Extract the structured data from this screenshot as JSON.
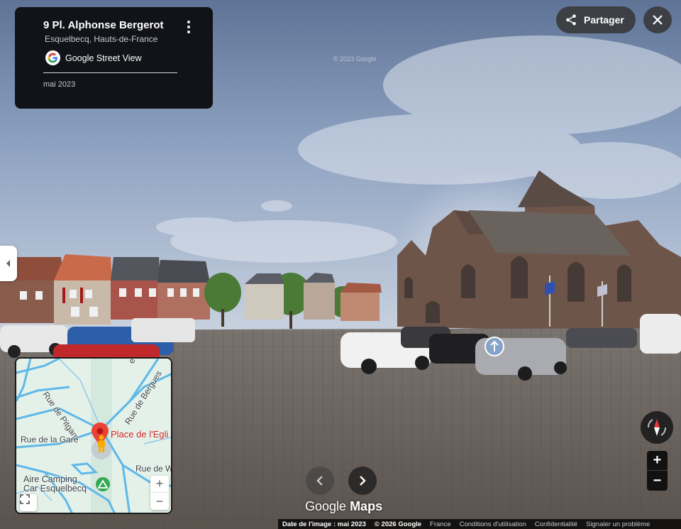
{
  "info_card": {
    "title": "9 Pl. Alphonse Bergerot",
    "subtitle": "Esquelbecq, Hauts-de-France",
    "provider": "Google Street View",
    "date": "mai 2023",
    "menu_icon": "more-vert-icon",
    "provider_icon": "google-g-icon"
  },
  "share": {
    "label": "Partager",
    "icon": "share-icon"
  },
  "close": {
    "icon": "close-icon"
  },
  "side_tab": {
    "icon": "chevron-left-icon"
  },
  "mini_map": {
    "streets": {
      "beelen": "eele",
      "bergues": "Rue de Bergues",
      "pitgam": "Rue de Pitgam",
      "gare": "Rue de la Gare",
      "rue_w": "Rue de W"
    },
    "place": "Place de l'Egli",
    "camping_line1": "Aire Camping",
    "camping_line2": "Car Esquelbecq",
    "zoom_in": "+",
    "zoom_out": "−",
    "expand_icon": "fullscreen-icon",
    "marker_icon": "map-pin-icon",
    "pegman_icon": "pegman-icon",
    "camping_icon": "camping-icon"
  },
  "nav": {
    "prev_icon": "chevron-left-icon",
    "next_icon": "chevron-right-icon"
  },
  "branding": {
    "google": "Google",
    "maps": "Maps"
  },
  "controls": {
    "compass_icon": "compass-icon",
    "zoom_in": "+",
    "zoom_out": "−"
  },
  "scene": {
    "watermark": "© 2023 Google",
    "pano_marker_icon": "arrow-up-circle-icon"
  },
  "footer": {
    "image_date": "Date de l'image : mai 2023",
    "copyright": "© 2026 Google",
    "country": "France",
    "terms": "Conditions d'utilisation",
    "privacy": "Confidentialité",
    "report": "Signaler un problème"
  },
  "colors": {
    "card_bg": "#111318",
    "button_bg": "#3c3f44",
    "marker_red": "#ea4335",
    "camp_green": "#34a853",
    "map_road": "#5fb8e8"
  }
}
